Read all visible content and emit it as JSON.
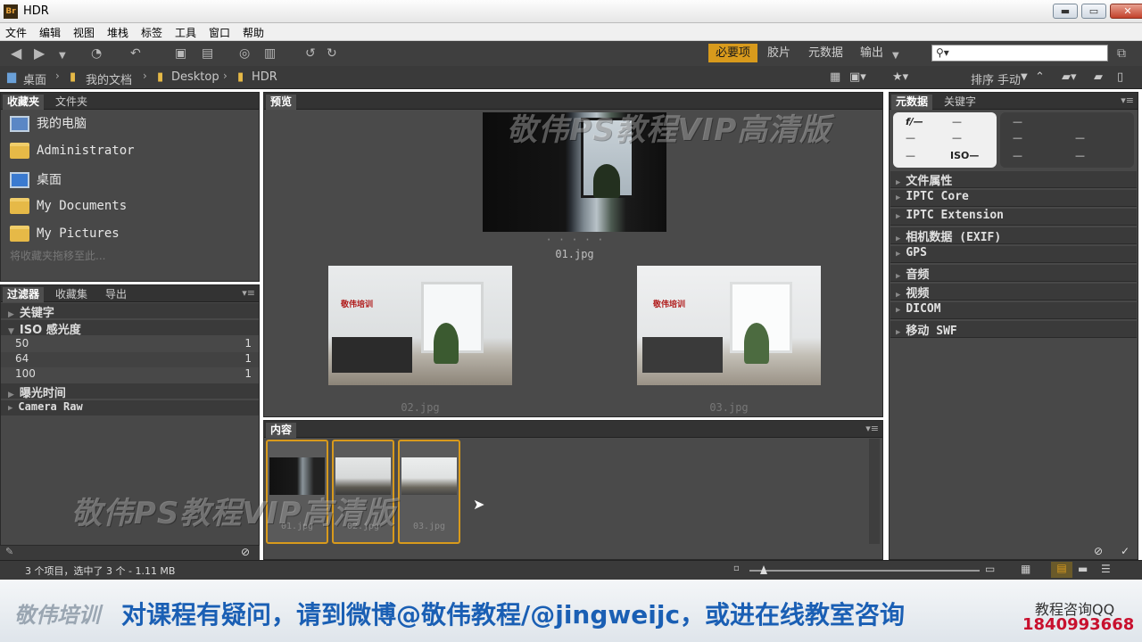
{
  "window": {
    "icon_text": "Br",
    "title": "HDR",
    "minimize": "▬",
    "maximize": "▭",
    "close": "✕"
  },
  "menu": [
    "文件",
    "编辑",
    "视图",
    "堆栈",
    "标签",
    "工具",
    "窗口",
    "帮助"
  ],
  "workspaces": {
    "essentials": "必要项",
    "filmstrip": "胶片",
    "metadata": "元数据",
    "output": "输出"
  },
  "search": {
    "placeholder": "",
    "icon": "search-icon"
  },
  "breadcrumb": [
    "桌面",
    "我的文档",
    "Desktop",
    "HDR"
  ],
  "sort": {
    "label": "排序",
    "value": "手动"
  },
  "favorites": {
    "tabs": [
      "收藏夹",
      "文件夹"
    ],
    "items": [
      "我的电脑",
      "Administrator",
      "桌面",
      "My Documents",
      "My Pictures"
    ],
    "hint": "将收藏夹拖移至此..."
  },
  "filter": {
    "tabs": [
      "过滤器",
      "收藏集",
      "导出"
    ],
    "keywords": "关键字",
    "iso_header": "ISO 感光度",
    "iso_rows": [
      {
        "label": "50",
        "count": "1"
      },
      {
        "label": "64",
        "count": "1"
      },
      {
        "label": "100",
        "count": "1"
      }
    ],
    "exposure": "曝光时间",
    "camera_raw": "Camera Raw"
  },
  "preview": {
    "tab": "预览",
    "watermark": "敬伟PS教程VIP高清版",
    "rating_dots": "· · · · ·",
    "images": [
      "01.jpg",
      "02.jpg",
      "03.jpg"
    ],
    "sign_text": "敬伟培训"
  },
  "content": {
    "tab": "内容",
    "thumbs": [
      "01.jpg",
      "02.jpg",
      "03.jpg"
    ],
    "watermark": "敬伟PS教程VIP高清版"
  },
  "metadata_panel": {
    "tabs": [
      "元数据",
      "关键字"
    ],
    "placard_left": [
      "f/—",
      "—",
      "—",
      "—",
      "—",
      "ISO—"
    ],
    "placard_right": [
      "—",
      "—",
      "—",
      "—",
      "—"
    ],
    "sections": [
      "文件属性",
      "IPTC Core",
      "IPTC Extension",
      "相机数据 (EXIF)",
      "GPS",
      "音频",
      "视频",
      "DICOM",
      "移动 SWF"
    ]
  },
  "status": {
    "text": "3 个项目，选中了 3 个 - 1.11 MB"
  },
  "banner": {
    "logo": "敬伟培训",
    "message": "对课程有疑问，请到微博@敬伟教程/@jingweijc，或进在线教室咨询",
    "qq_label": "教程咨询QQ",
    "qq_number": "1840993668"
  },
  "colors": {
    "accent": "#d89a1c",
    "panel": "#484848",
    "dark": "#333333",
    "banner_text": "#1a5fb4",
    "qq_red": "#c8102e"
  }
}
